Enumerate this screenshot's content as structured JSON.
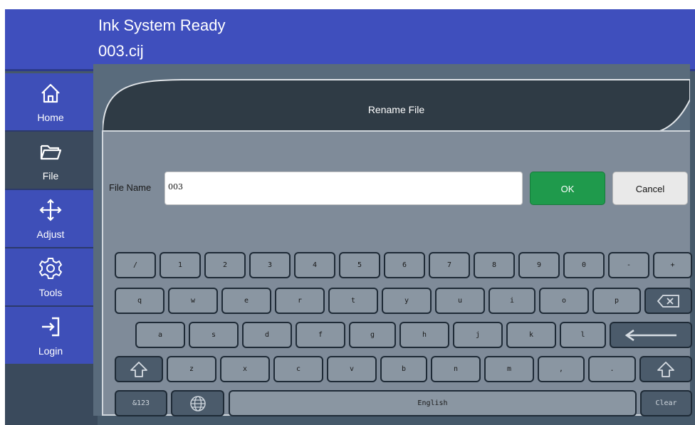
{
  "header": {
    "status": "Ink System Ready",
    "filename": "003.cij"
  },
  "sidebar": {
    "items": [
      {
        "label": "Home",
        "icon": "home-icon"
      },
      {
        "label": "File",
        "icon": "folder-icon"
      },
      {
        "label": "Adjust",
        "icon": "move-arrows-icon"
      },
      {
        "label": "Tools",
        "icon": "gear-icon"
      },
      {
        "label": "Login",
        "icon": "login-icon"
      }
    ],
    "active": "File"
  },
  "dialog": {
    "title": "Rename File",
    "field_label": "File Name",
    "field_value": "003",
    "ok_label": "OK",
    "cancel_label": "Cancel"
  },
  "keyboard": {
    "row1": [
      "/",
      "1",
      "2",
      "3",
      "4",
      "5",
      "6",
      "7",
      "8",
      "9",
      "0",
      "-",
      "+"
    ],
    "row2": [
      "q",
      "w",
      "e",
      "r",
      "t",
      "y",
      "u",
      "i",
      "o",
      "p"
    ],
    "row3": [
      "a",
      "s",
      "d",
      "f",
      "g",
      "h",
      "j",
      "k",
      "l"
    ],
    "row4": [
      "z",
      "x",
      "c",
      "v",
      "b",
      "n",
      "m",
      ",",
      "."
    ],
    "symbols_label": "&123",
    "space_label": "English",
    "clear_label": "Clear"
  },
  "colors": {
    "header": "#3f4fbd",
    "nav": "#3e4fb8",
    "ok": "#1f9a4c",
    "panel": "#7f8b99",
    "key": "#8a96a2"
  }
}
